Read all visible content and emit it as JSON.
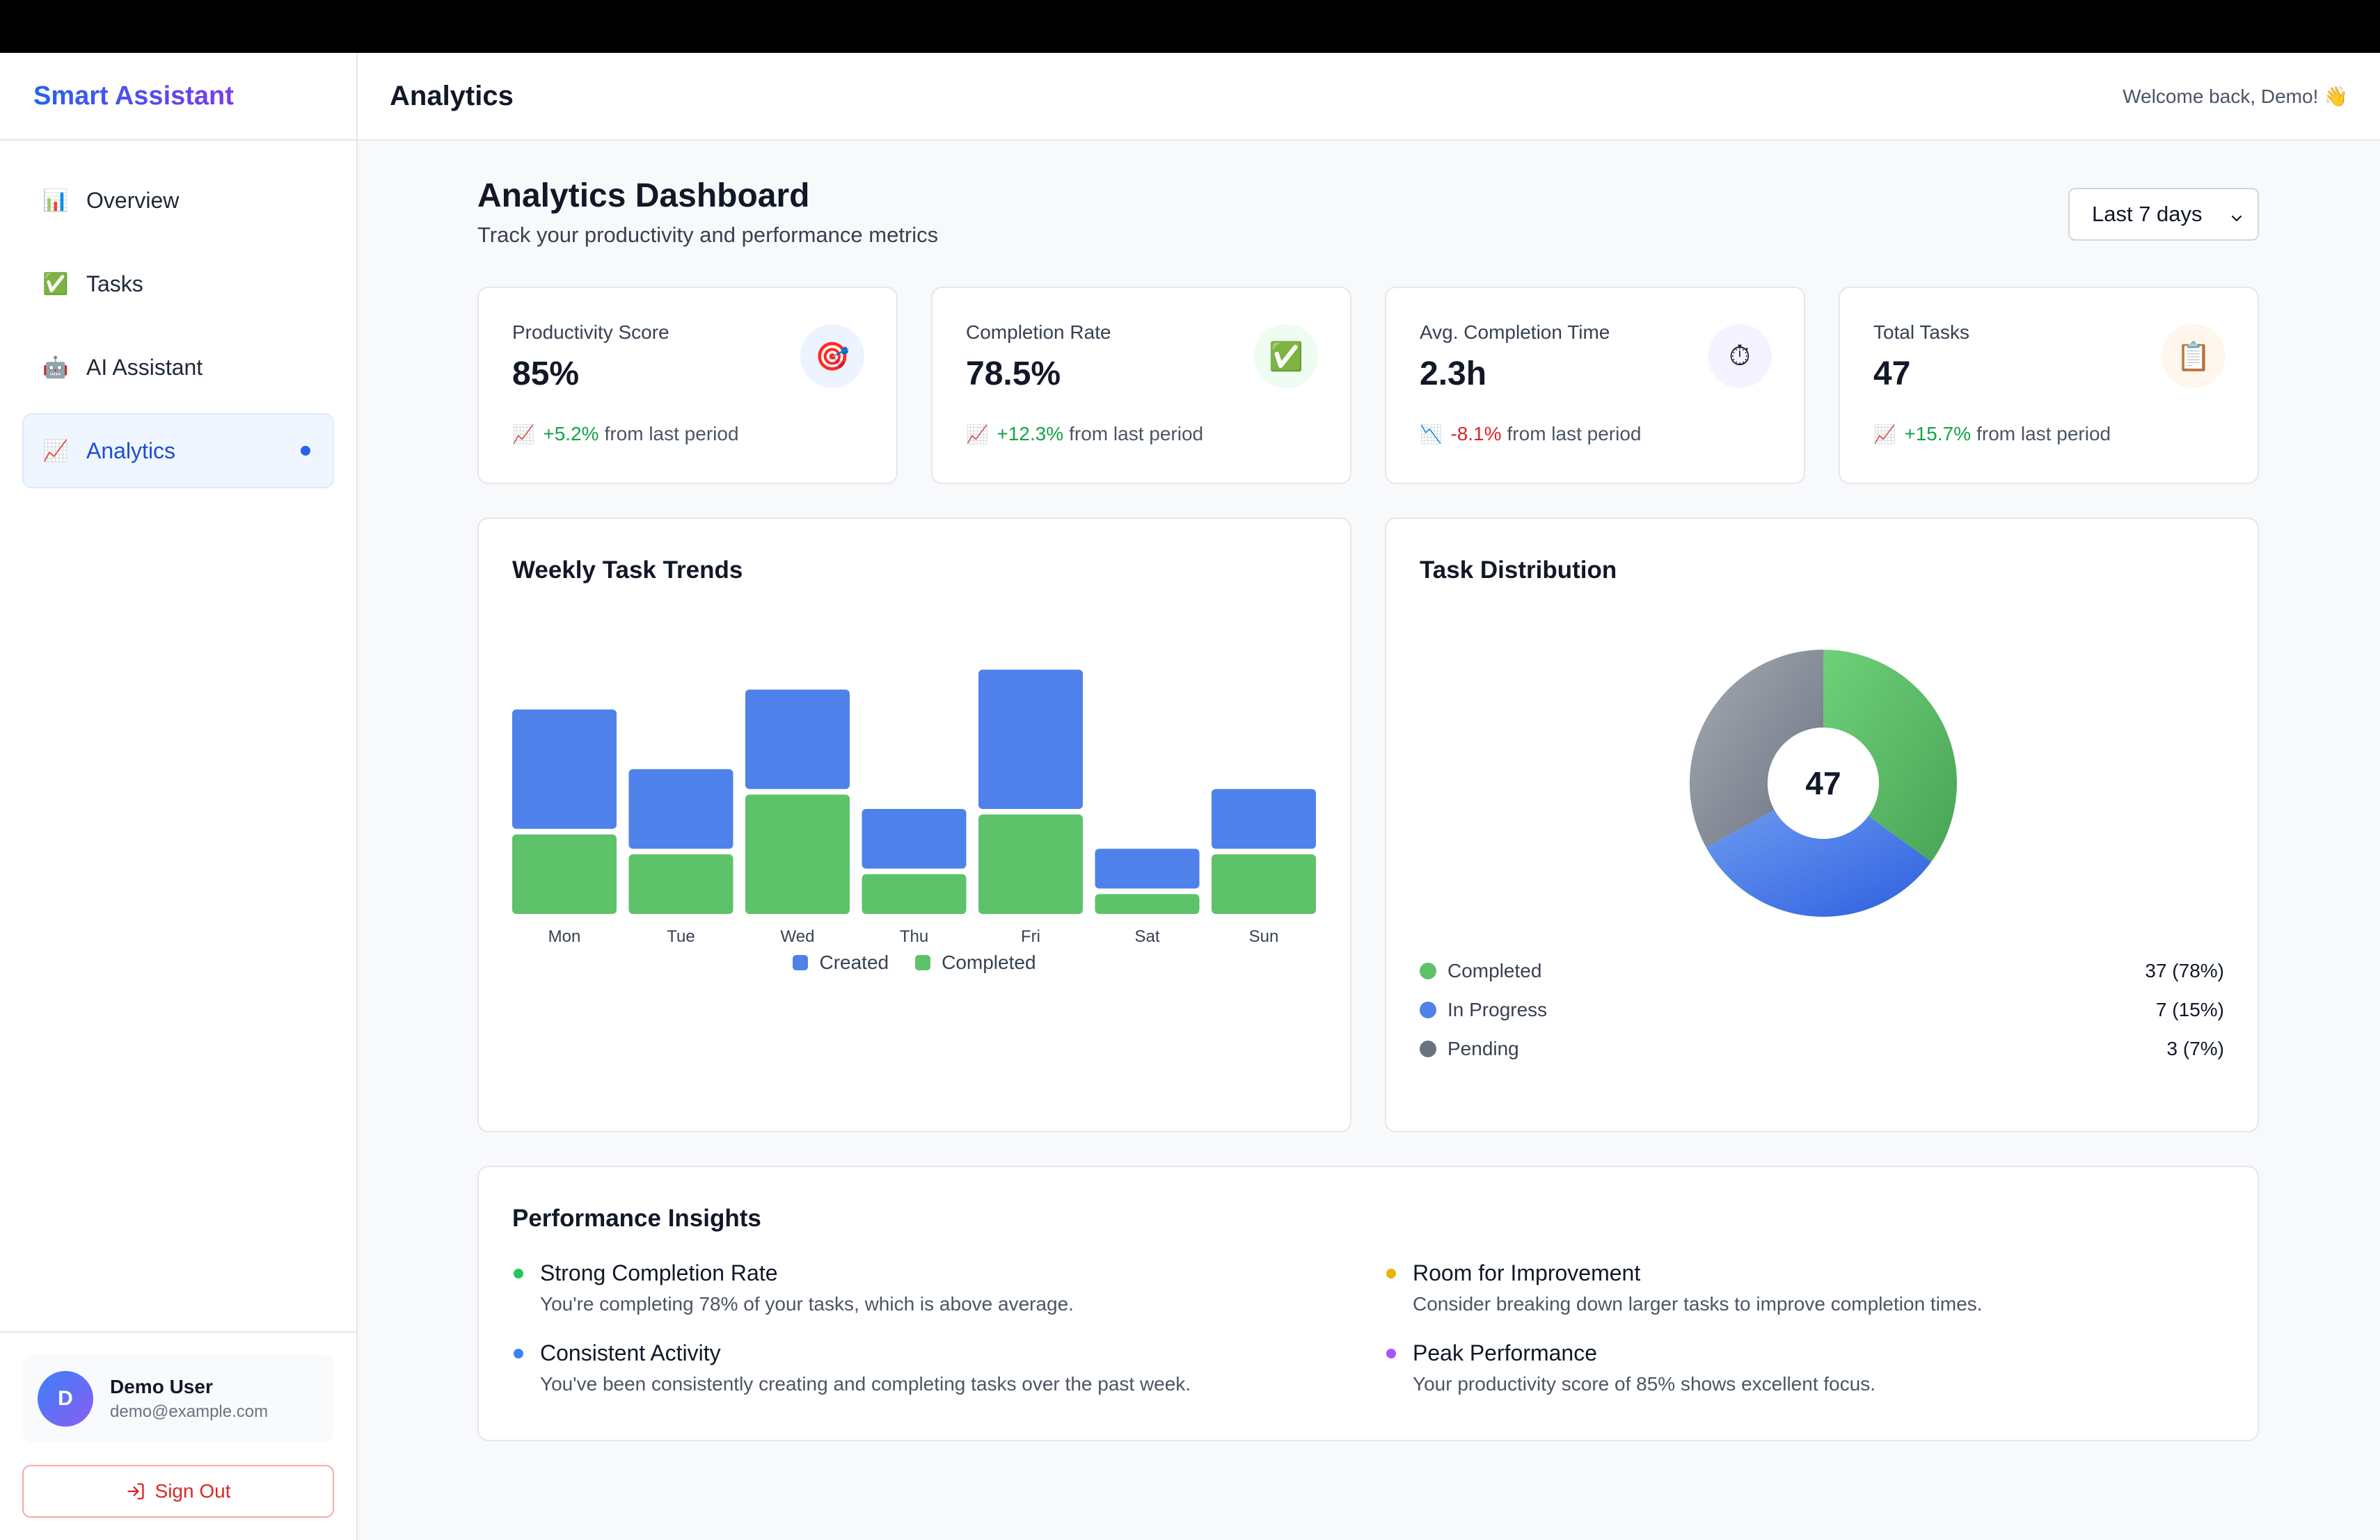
{
  "app": {
    "brand": "Smart Assistant"
  },
  "sidebar": {
    "items": [
      {
        "label": "Overview",
        "icon": "bar-chart-icon",
        "glyph": "📊"
      },
      {
        "label": "Tasks",
        "icon": "check-box-icon",
        "glyph": "✅"
      },
      {
        "label": "AI Assistant",
        "icon": "robot-icon",
        "glyph": "🤖"
      },
      {
        "label": "Analytics",
        "icon": "trend-chart-icon",
        "glyph": "📈",
        "active": true
      }
    ],
    "user": {
      "initial": "D",
      "name": "Demo User",
      "email": "demo@example.com"
    },
    "signout_label": "Sign Out"
  },
  "header": {
    "title": "Analytics",
    "welcome": "Welcome back, Demo! 👋"
  },
  "page": {
    "title": "Analytics Dashboard",
    "subtitle": "Track your productivity and performance metrics",
    "range": "Last 7 days"
  },
  "stats": [
    {
      "label": "Productivity Score",
      "value": "85%",
      "change": "+5.2%",
      "direction": "up",
      "suffix": "from last period",
      "icon": "target-icon",
      "glyph": "🎯",
      "icon_bg": "#eef4ff"
    },
    {
      "label": "Completion Rate",
      "value": "78.5%",
      "change": "+12.3%",
      "direction": "up",
      "suffix": "from last period",
      "icon": "check-box-icon",
      "glyph": "✅",
      "icon_bg": "#eefcf2"
    },
    {
      "label": "Avg. Completion Time",
      "value": "2.3h",
      "change": "-8.1%",
      "direction": "down",
      "suffix": "from last period",
      "icon": "stopwatch-icon",
      "glyph": "⏱",
      "icon_bg": "#f5f3ff"
    },
    {
      "label": "Total Tasks",
      "value": "47",
      "change": "+15.7%",
      "direction": "up",
      "suffix": "from last period",
      "icon": "clipboard-icon",
      "glyph": "📋",
      "icon_bg": "#fff7ed"
    }
  ],
  "trends": {
    "title": "Weekly Task Trends",
    "legend": {
      "created": "Created",
      "completed": "Completed"
    },
    "colors": {
      "created": "#4f81ea",
      "completed": "#5ec26a"
    }
  },
  "distribution": {
    "title": "Task Distribution",
    "center": "47",
    "items": [
      {
        "label": "Completed",
        "value": "37 (78%)",
        "color": "#5ec26a"
      },
      {
        "label": "In Progress",
        "value": "7 (15%)",
        "color": "#4f81ea"
      },
      {
        "label": "Pending",
        "value": "3 (7%)",
        "color": "#6b7280"
      }
    ]
  },
  "chart_data": [
    {
      "type": "bar",
      "title": "Weekly Task Trends",
      "categories": [
        "Mon",
        "Tue",
        "Wed",
        "Thu",
        "Fri",
        "Sat",
        "Sun"
      ],
      "series": [
        {
          "name": "Created",
          "values": [
            6,
            4,
            5,
            3,
            7,
            2,
            3
          ]
        },
        {
          "name": "Completed",
          "values": [
            4,
            3,
            6,
            2,
            5,
            1,
            3
          ]
        }
      ],
      "legend": "bottom",
      "grid": false
    },
    {
      "type": "pie",
      "title": "Task Distribution",
      "categories": [
        "Completed",
        "In Progress",
        "Pending"
      ],
      "values": [
        37,
        7,
        3
      ],
      "center_label": "47"
    }
  ],
  "insights": {
    "title": "Performance Insights",
    "items": [
      {
        "title": "Strong Completion Rate",
        "desc": "You're completing 78% of your tasks, which is above average.",
        "color": "#22c55e"
      },
      {
        "title": "Room for Improvement",
        "desc": "Consider breaking down larger tasks to improve completion times.",
        "color": "#eab308"
      },
      {
        "title": "Consistent Activity",
        "desc": "You've been consistently creating and completing tasks over the past week.",
        "color": "#3b82f6"
      },
      {
        "title": "Peak Performance",
        "desc": "Your productivity score of 85% shows excellent focus.",
        "color": "#a855f7"
      }
    ]
  }
}
